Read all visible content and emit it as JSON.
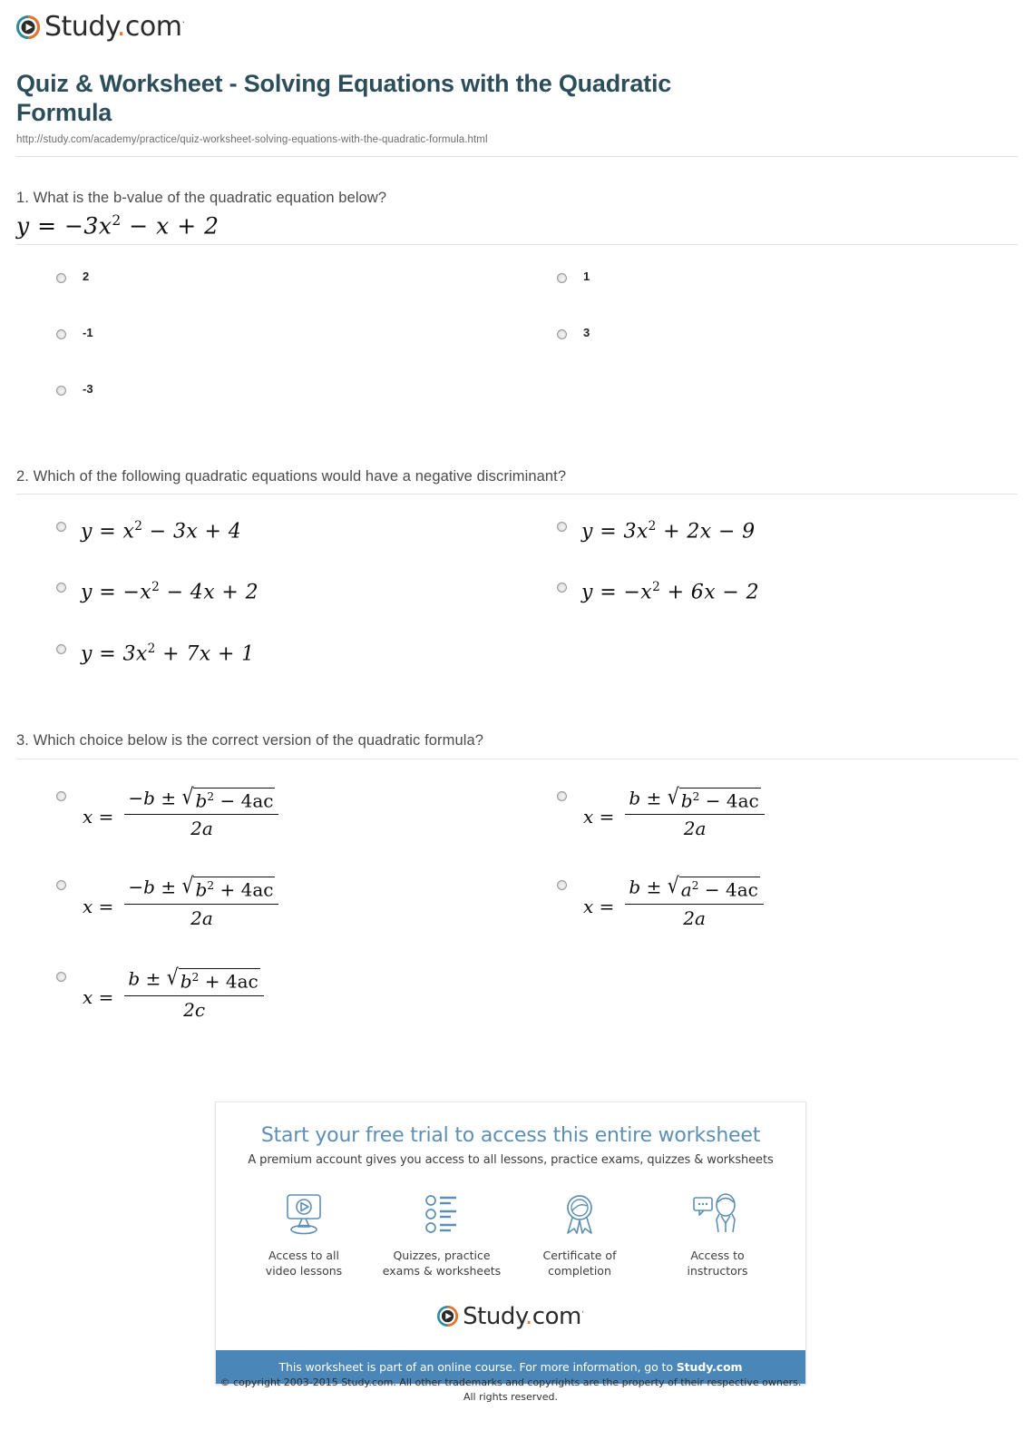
{
  "brand": {
    "name": "Study.com",
    "name_part1": "Study",
    "name_dot": ".",
    "name_part2": "com",
    "trademark": "·",
    "logo_icon": "play-circle-icon",
    "teal": "#2e8b9e",
    "orange": "#e8742c",
    "title_color": "#2c4e5a",
    "bar_color": "#4a86b8",
    "promo_title_color": "#5d8fb5"
  },
  "header": {
    "title": "Quiz & Worksheet - Solving Equations with the Quadratic Formula",
    "url": "http://study.com/academy/practice/quiz-worksheet-solving-equations-with-the-quadratic-formula.html"
  },
  "questions": [
    {
      "number": "1.",
      "prompt": "What is the b-value of the quadratic equation below?",
      "equation": {
        "lhs": "y",
        "eq": "=",
        "terms": "− 3x² − x + 2",
        "base": "y = −3x",
        "exponent": "2",
        "tail": "− x + 2"
      },
      "options_left": [
        "2",
        "-1",
        "-3"
      ],
      "options_right": [
        "1",
        "3"
      ]
    },
    {
      "number": "2.",
      "prompt": "Which of the following quadratic equations would have a negative discriminant?",
      "options_left": [
        {
          "pre": "y = x",
          "exp": "2",
          "post": " − 3x + 4"
        },
        {
          "pre": "y = −x",
          "exp": "2",
          "post": " − 4x + 2"
        },
        {
          "pre": "y = 3x",
          "exp": "2",
          "post": " + 7x + 1"
        }
      ],
      "options_right": [
        {
          "pre": "y = 3x",
          "exp": "2",
          "post": " + 2x − 9"
        },
        {
          "pre": "y = −x",
          "exp": "2",
          "post": " + 6x − 2"
        }
      ]
    },
    {
      "number": "3.",
      "prompt": "Which choice below is the correct version of the quadratic formula?",
      "options_left": [
        {
          "lhs": "x =",
          "num_pre": "−b ±",
          "rad_base": "b",
          "rad_exp": "2",
          "rad_tail": "− 4ac",
          "denom": "2a"
        },
        {
          "lhs": "x =",
          "num_pre": "−b ±",
          "rad_base": "b",
          "rad_exp": "2",
          "rad_tail": "+ 4ac",
          "denom": "2a"
        },
        {
          "lhs": "x =",
          "num_pre": "b ±",
          "rad_base": "b",
          "rad_exp": "2",
          "rad_tail": "+ 4ac",
          "denom": "2c"
        }
      ],
      "options_right": [
        {
          "lhs": "x =",
          "num_pre": "b ±",
          "rad_base": "b",
          "rad_exp": "2",
          "rad_tail": "− 4ac",
          "denom": "2a"
        },
        {
          "lhs": "x =",
          "num_pre": "b ±",
          "rad_base": "a",
          "rad_exp": "2",
          "rad_tail": "− 4ac",
          "denom": "2a"
        }
      ]
    }
  ],
  "promo": {
    "title": "Start your free trial to access this entire worksheet",
    "subtitle": "A premium account gives you access to all lessons, practice exams, quizzes & worksheets",
    "perks": [
      {
        "icon": "monitor-play-icon",
        "line1": "Access to all",
        "line2": "video lessons"
      },
      {
        "icon": "checklist-icon",
        "line1": "Quizzes, practice",
        "line2": "exams & worksheets"
      },
      {
        "icon": "award-ribbon-icon",
        "line1": "Certificate of",
        "line2": "completion"
      },
      {
        "icon": "instructor-chat-icon",
        "line1": "Access to",
        "line2": "instructors"
      }
    ],
    "bar_text_pre": "This worksheet is part of an online course. For more information, go to ",
    "bar_text_brand": "Study.com"
  },
  "footer": {
    "copyright_line1": "© copyright 2003-2015 Study.com. All other trademarks and copyrights are the property of their respective owners.",
    "copyright_line2": "All rights reserved."
  }
}
